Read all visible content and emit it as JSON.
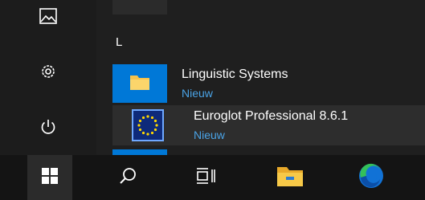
{
  "start_menu": {
    "left_rail": {
      "items": [
        {
          "name": "pictures",
          "icon": "pictures-icon"
        },
        {
          "name": "settings",
          "icon": "gear-icon"
        },
        {
          "name": "power",
          "icon": "power-icon"
        }
      ]
    },
    "section_letter": "L",
    "apps": [
      {
        "name": "Linguistic Systems",
        "badge": "Nieuw",
        "icon": "folder-icon",
        "tile_color": "#0078d7"
      },
      {
        "name": "Euroglot Professional 8.6.1",
        "badge": "Nieuw",
        "icon": "euroglot-eu-flag-icon"
      }
    ]
  },
  "taskbar": {
    "items": [
      {
        "name": "start",
        "icon": "windows-logo-icon"
      },
      {
        "name": "search",
        "icon": "search-icon"
      },
      {
        "name": "task-view",
        "icon": "task-view-icon"
      },
      {
        "name": "file-explorer",
        "icon": "file-explorer-icon"
      },
      {
        "name": "edge",
        "icon": "edge-icon"
      }
    ]
  },
  "colors": {
    "accent": "#0078d7",
    "badge_text": "#4aa3e6",
    "menu_bg": "#1f1f1f",
    "taskbar_bg": "#141414"
  }
}
